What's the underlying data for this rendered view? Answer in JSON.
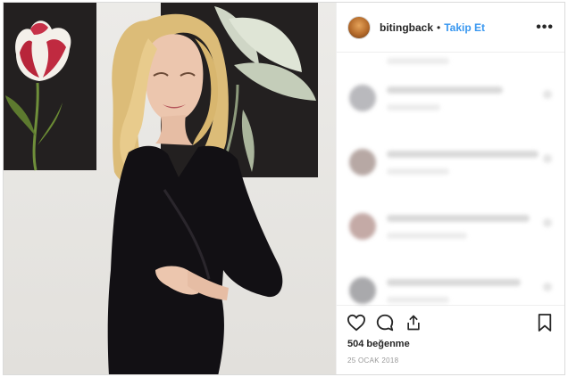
{
  "post": {
    "username": "bitingback",
    "separator": "•",
    "follow_label": "Takip Et",
    "more_label": "•••",
    "likes": "504 beğenme",
    "date": "25 OCAK 2018"
  },
  "icons": {
    "like": "heart-icon",
    "comment": "comment-icon",
    "share": "share-icon",
    "save": "bookmark-icon",
    "more": "more-options-icon"
  },
  "colors": {
    "follow": "#3897f0",
    "dress": "#121014",
    "hair": "#e2c27c"
  }
}
